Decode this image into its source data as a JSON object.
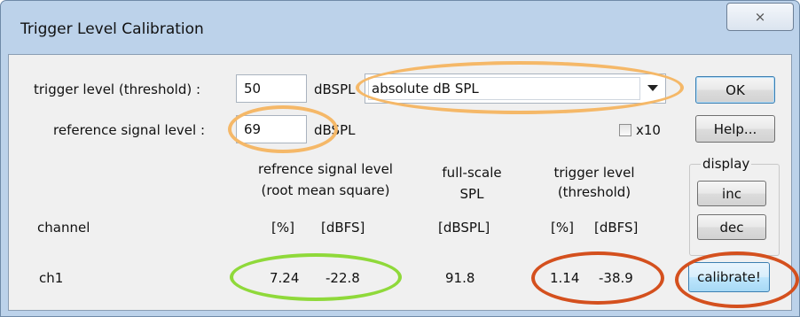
{
  "window": {
    "title": "Trigger Level Calibration",
    "close_glyph": "⨯",
    "close_icon": "close-icon"
  },
  "trigger": {
    "label": "trigger level (threshold) :",
    "value": "50",
    "unit": "dBSPL"
  },
  "mode_select": {
    "selected": "absolute dB SPL",
    "icon": "chevron-down-icon"
  },
  "reference": {
    "label": "reference signal level :",
    "value": "69",
    "unit": "dBSPL"
  },
  "x10_checkbox": {
    "label": "x10",
    "checked": false
  },
  "buttons": {
    "ok": "OK",
    "help": "Help...",
    "inc": "inc",
    "dec": "dec",
    "calibrate": "calibrate!"
  },
  "display_group": {
    "legend": "display"
  },
  "headers": {
    "ref_line1": "refrence signal level",
    "ref_line2": "(root mean square)",
    "fs_line1": "full-scale",
    "fs_line2": "SPL",
    "trig_line1": "trigger level",
    "trig_line2": "(threshold)",
    "channel": "channel",
    "ref_pct": "[%]",
    "ref_dbfs": "[dBFS]",
    "fs_unit": "[dBSPL]",
    "trig_pct": "[%]",
    "trig_dbfs": "[dBFS]"
  },
  "rows": [
    {
      "channel": "ch1",
      "ref_pct": "7.24",
      "ref_dbfs": "-22.8",
      "full_scale": "91.8",
      "trig_pct": "1.14",
      "trig_dbfs": "-38.9"
    }
  ],
  "annotation_colors": {
    "orange": "#f5b868",
    "green": "#8fd93a",
    "red": "#d4501e"
  },
  "ui_colors": {
    "frame": "#bcd2ea",
    "client": "#f0f0f0",
    "focus_button": "#a7d9f5"
  }
}
